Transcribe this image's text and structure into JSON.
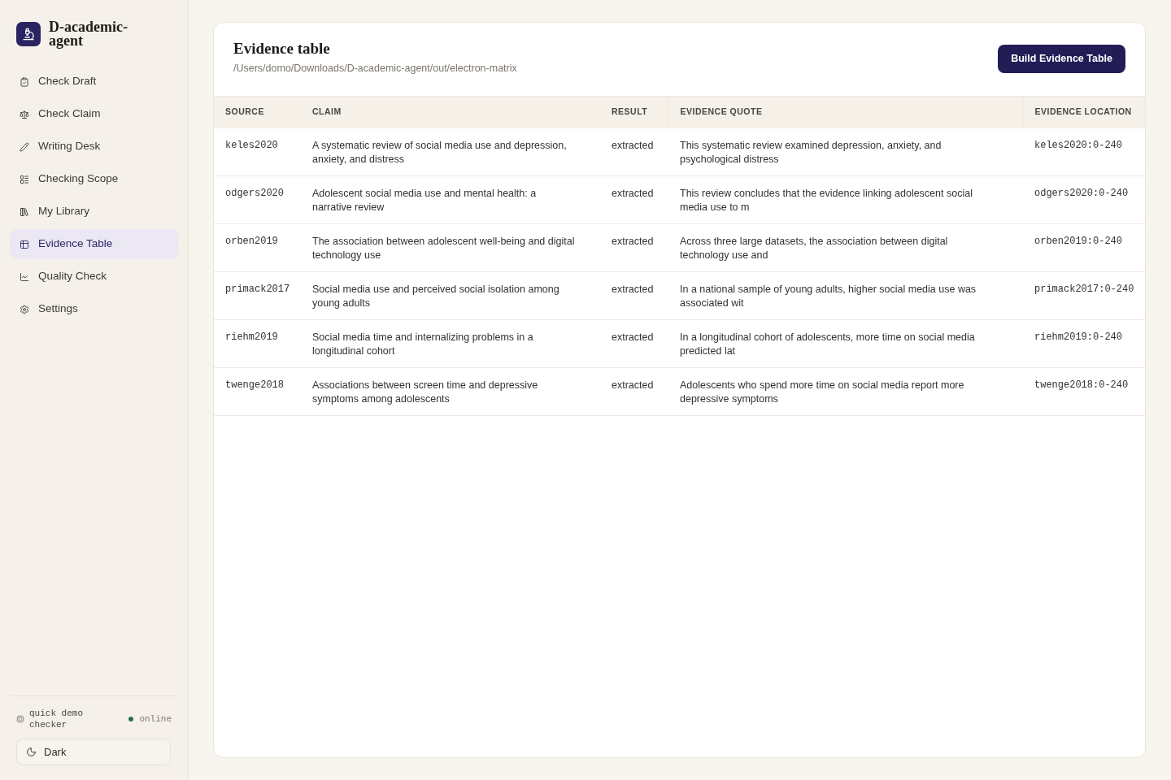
{
  "app": {
    "name": "D-academic-agent"
  },
  "nav": [
    {
      "label": "Check Draft",
      "selected": false
    },
    {
      "label": "Check Claim",
      "selected": false
    },
    {
      "label": "Writing Desk",
      "selected": false
    },
    {
      "label": "Checking Scope",
      "selected": false
    },
    {
      "label": "My Library",
      "selected": false
    },
    {
      "label": "Evidence Table",
      "selected": true
    },
    {
      "label": "Quality Check",
      "selected": false
    },
    {
      "label": "Settings",
      "selected": false
    }
  ],
  "engine": {
    "label": "quick demo checker",
    "status": "online",
    "online": true
  },
  "theme_button": {
    "label": "Dark"
  },
  "page": {
    "title": "Evidence table",
    "path": "/Users/domo/Downloads/D-academic-agent/out/electron-matrix",
    "action": "Build Evidence Table"
  },
  "table": {
    "columns": [
      "SOURCE",
      "CLAIM",
      "RESULT",
      "EVIDENCE QUOTE",
      "EVIDENCE LOCATION"
    ],
    "rows": [
      {
        "source": "keles2020",
        "claim": "A systematic review of social media use and depression, anxiety, and distress",
        "result": "extracted",
        "quote": "This systematic review examined depression, anxiety, and psychological distress",
        "location": "keles2020:0-240"
      },
      {
        "source": "odgers2020",
        "claim": "Adolescent social media use and mental health: a narrative review",
        "result": "extracted",
        "quote": "This review concludes that the evidence linking adolescent social media use to m",
        "location": "odgers2020:0-240"
      },
      {
        "source": "orben2019",
        "claim": "The association between adolescent well-being and digital technology use",
        "result": "extracted",
        "quote": "Across three large datasets, the association between digital technology use and",
        "location": "orben2019:0-240"
      },
      {
        "source": "primack2017",
        "claim": "Social media use and perceived social isolation among young adults",
        "result": "extracted",
        "quote": "In a national sample of young adults, higher social media use was associated wit",
        "location": "primack2017:0-240"
      },
      {
        "source": "riehm2019",
        "claim": "Social media time and internalizing problems in a longitudinal cohort",
        "result": "extracted",
        "quote": "In a longitudinal cohort of adolescents, more time on social media predicted lat",
        "location": "riehm2019:0-240"
      },
      {
        "source": "twenge2018",
        "claim": "Associations between screen time and depressive symptoms among adolescents",
        "result": "extracted",
        "quote": "Adolescents who spend more time on social media report more depressive symptoms",
        "location": "twenge2018:0-240"
      }
    ]
  }
}
